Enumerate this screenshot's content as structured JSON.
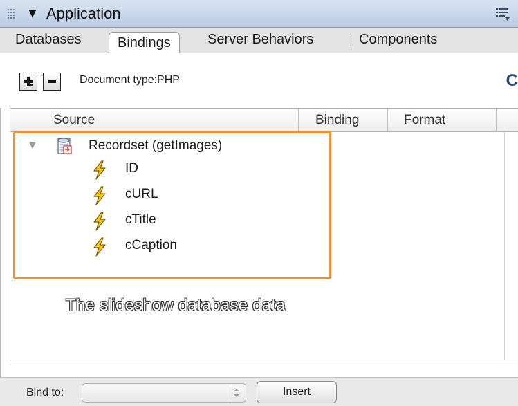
{
  "panel": {
    "title": "Application"
  },
  "tabs": [
    {
      "label": "Databases",
      "active": false
    },
    {
      "label": "Bindings",
      "active": true
    },
    {
      "label": "Server Behaviors",
      "active": false
    },
    {
      "label": "Components",
      "active": false
    }
  ],
  "toolbar": {
    "add_symbol": "+",
    "remove_symbol": "−",
    "document_type": "Document type:PHP",
    "refresh_symbol": "C"
  },
  "table": {
    "columns": [
      "Source",
      "Binding",
      "Format"
    ],
    "recordset": {
      "label": "Recordset (getImages)",
      "fields": [
        "ID",
        "cURL",
        "cTitle",
        "cCaption"
      ]
    }
  },
  "annotation": {
    "text": "The slideshow database data",
    "highlight_color": "#f28f2b"
  },
  "footer": {
    "bind_to_label": "Bind to:",
    "bind_to_value": "",
    "insert_label": "Insert"
  },
  "icons": {
    "grip": "panel-grip-icon",
    "collapse": "triangle-down-icon",
    "menu": "options-menu-icon",
    "recordset": "recordset-icon",
    "field": "lightning-bolt-icon",
    "refresh": "refresh-icon"
  }
}
